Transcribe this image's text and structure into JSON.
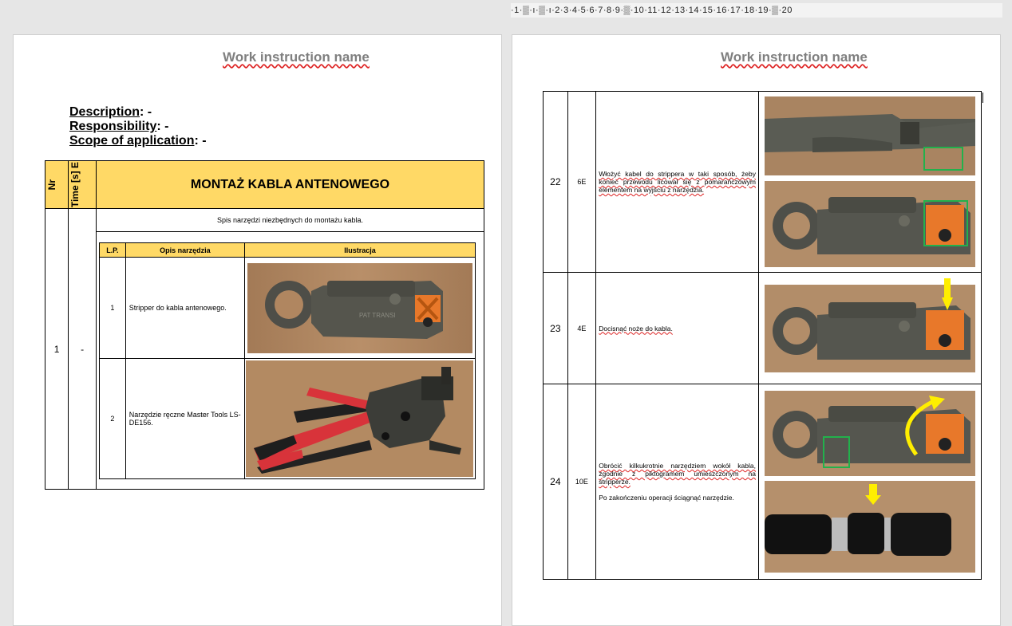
{
  "ruler": {
    "ticks": "·1·▒·ı·▒·ı·2·3·4·5·6·7·8·9·▒·10·11·12·13·14·15·16·17·18·19·▒·20"
  },
  "page1": {
    "title": "Work instruction name",
    "description_label": "Description",
    "description_value": ": -",
    "responsibility_label": "Responsibility",
    "responsibility_value": ": -",
    "scope_label": "Scope of application",
    "scope_value": ": -",
    "table": {
      "col_nr": "Nr",
      "col_time": "Time [s] E",
      "heading": "MONTAŻ KABLA ANTENOWEGO",
      "row_nr": "1",
      "row_time": "-",
      "subtitle": "Spis narzędzi niezbędnych do montażu kabla.",
      "inner_headers": [
        "L.P.",
        "Opis narzędzia",
        "Ilustracja"
      ],
      "tools": [
        {
          "lp": "1",
          "desc": "Stripper do kabla antenowego."
        },
        {
          "lp": "2",
          "desc": "Narzędzie ręczne Master Tools LS-DE156."
        }
      ]
    }
  },
  "page2": {
    "title": "Work instruction name",
    "steps": [
      {
        "nr": "22",
        "time": "6E",
        "text": "Włożyć kabel do strippera w taki sposób, żeby koniec przewodu licował się z pomarańczowym elementem na wyjściu z narzędzia.",
        "text2": ""
      },
      {
        "nr": "23",
        "time": "4E",
        "text": "Docisnąć noże do kabla.",
        "text2": ""
      },
      {
        "nr": "24",
        "time": "10E",
        "text": "Obrócić kilkukrotnie narzędziem wokół kabla, zgodnie z piktogramem umieszczonym na stripperze.",
        "text2": "Po zakończeniu operacji ściągnąć narzędzie."
      }
    ]
  },
  "colors": {
    "header_fill": "#ffd966",
    "title_gray": "#7f7f7f",
    "highlight_green": "#22b14c",
    "arrow_yellow": "#ffee00"
  }
}
